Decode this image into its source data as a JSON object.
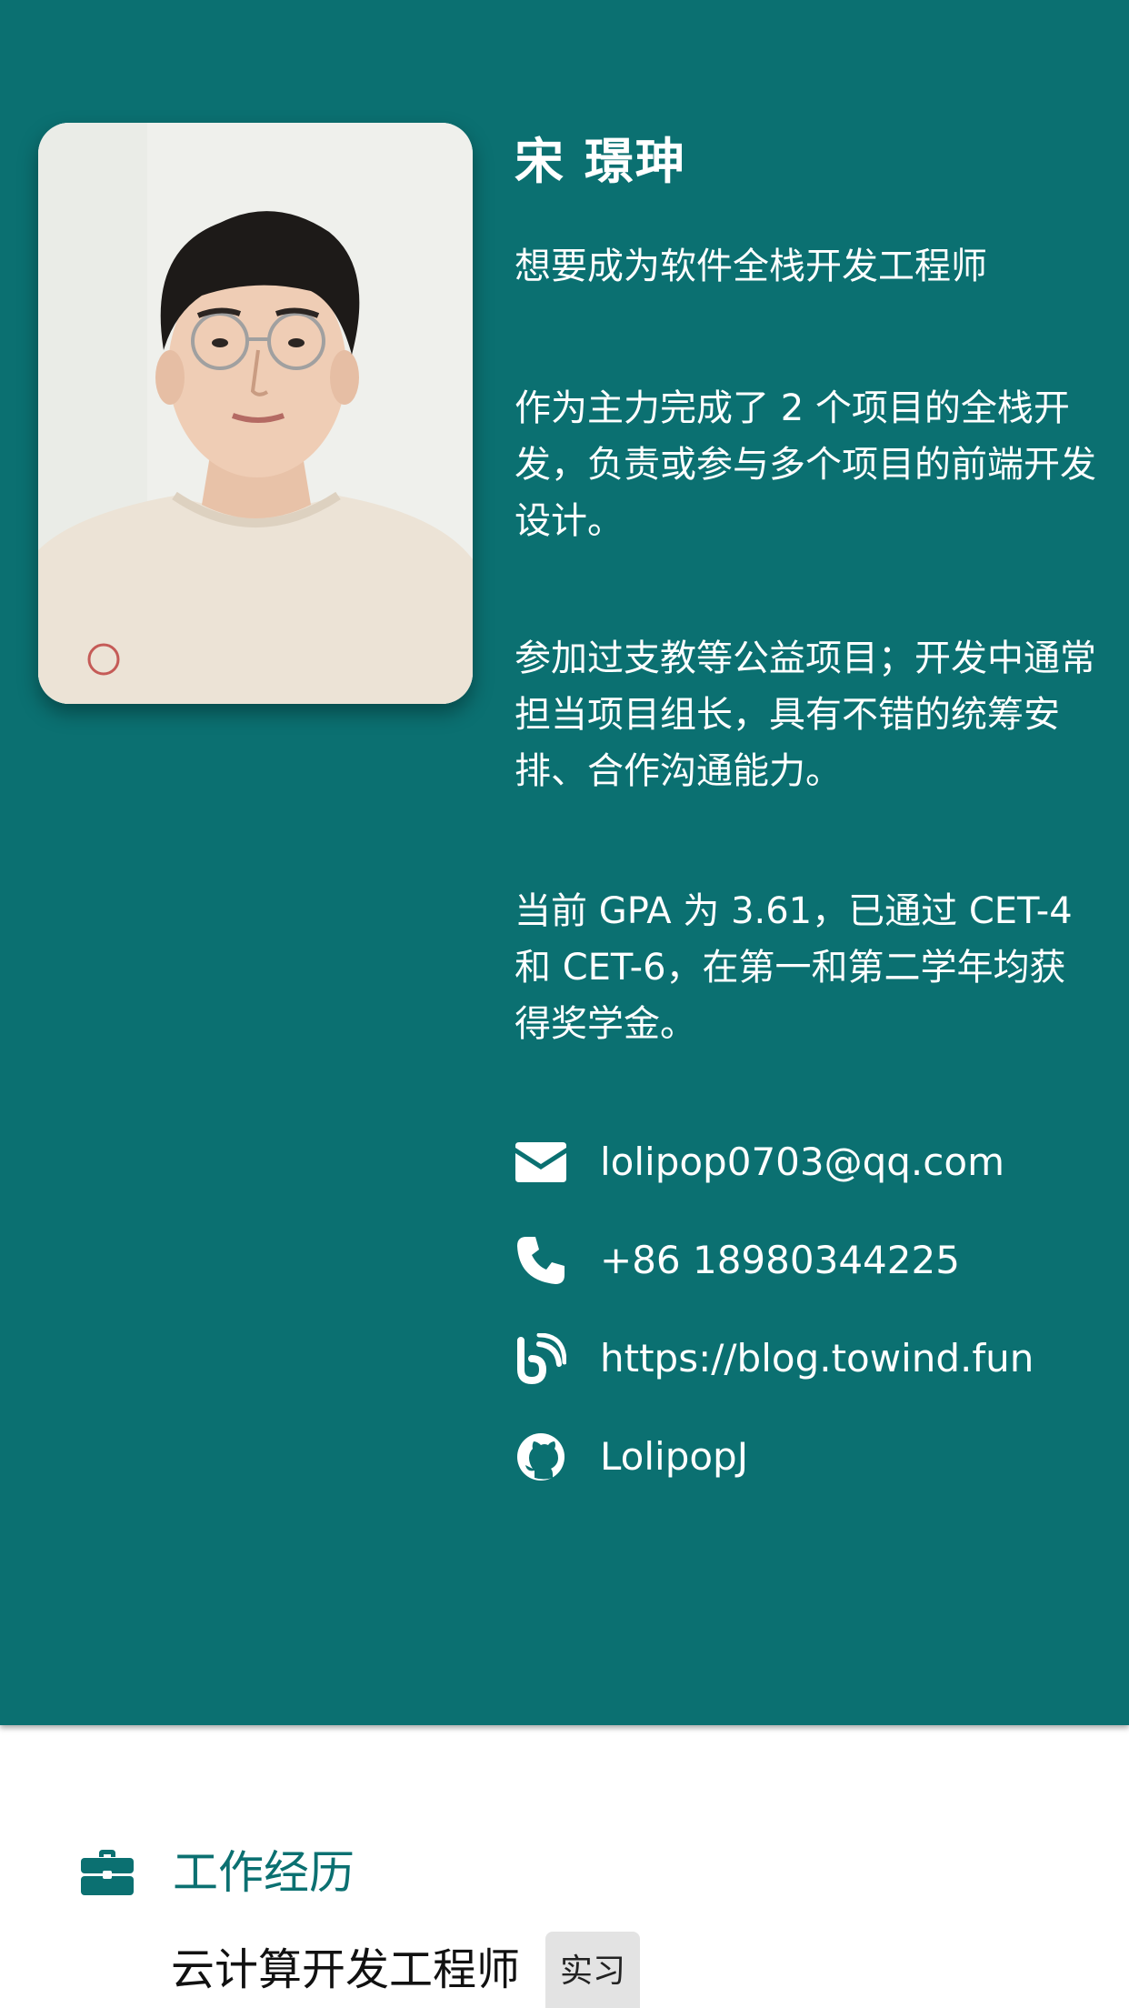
{
  "profile": {
    "name": "宋 璟珅",
    "tagline": "想要成为软件全栈开发工程师",
    "summary_1": "作为主力完成了 2 个项目的全栈开发，负责或参与多个项目的前端开发设计。",
    "summary_2": "参加过支教等公益项目；开发中通常担当项目组长，具有不错的统筹安排、合作沟通能力。",
    "summary_3": "当前 GPA 为 3.61，已通过 CET-4 和 CET-6，在第一和第二学年均获得奖学金。"
  },
  "contacts": [
    {
      "icon": "envelope-icon",
      "value": "lolipop0703@qq.com"
    },
    {
      "icon": "phone-icon",
      "value": "+86 18980344225"
    },
    {
      "icon": "blog-icon",
      "value": "https://blog.towind.fun"
    },
    {
      "icon": "github-icon",
      "value": "LolipopJ"
    }
  ],
  "experience": {
    "icon": "briefcase-icon",
    "title": "工作经历",
    "job_title": "云计算开发工程师",
    "job_badge": "实习"
  },
  "colors": {
    "accent": "#0b7071",
    "text_on_accent": "#ffffff",
    "badge_bg": "#e3e3e3"
  }
}
